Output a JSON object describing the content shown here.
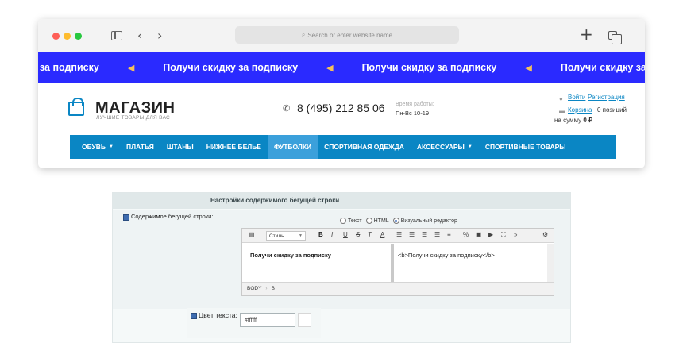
{
  "browser": {
    "address_placeholder": "Search or enter website name",
    "icons": [
      "sidebar-icon",
      "back-icon",
      "forward-icon",
      "search-icon",
      "new-tab-icon",
      "tabs-icon"
    ]
  },
  "ticker": {
    "lead_text": "за подписку",
    "text": "Получи скидку за подписку",
    "background": "#2a2aff"
  },
  "shop": {
    "logo_title": "МАГАЗИН",
    "logo_subtitle": "ЛУЧШИЕ ТОВАРЫ ДЛЯ ВАС",
    "phone": "8 (495) 212 85 06",
    "hours_label": "Время работы:",
    "hours": "Пн-Вс 10-19",
    "login": "Войти",
    "register": "Регистрация",
    "cart_link": "Корзина",
    "cart_count": "0 позиций",
    "cart_sum_prefix": "на сумму",
    "cart_sum_value": "0 ₽",
    "accent": "#0a86c4"
  },
  "menu": {
    "items": [
      {
        "label": "ОБУВЬ",
        "dropdown": true
      },
      {
        "label": "ПЛАТЬЯ"
      },
      {
        "label": "ШТАНЫ"
      },
      {
        "label": "НИЖНЕЕ БЕЛЬЕ"
      },
      {
        "label": "ФУТБОЛКИ",
        "active": true
      },
      {
        "label": "СПОРТИВНАЯ ОДЕЖДА"
      },
      {
        "label": "АКСЕССУАРЫ",
        "dropdown": true
      },
      {
        "label": "СПОРТИВНЫЕ ТОВАРЫ"
      }
    ]
  },
  "settings": {
    "header": "Настройки содержимого бегущей строки",
    "content_label": "Содержимое бегущей строки:",
    "radio": {
      "text": "Текст",
      "html": "HTML",
      "visual": "Визуальный редактор",
      "selected": "visual"
    },
    "editor": {
      "style_select": "Стиль",
      "visual_content": "Получи скидку за подписку",
      "source_content": "<b>Получи скидку за подписку</b>",
      "status_body": "BODY",
      "status_b": "B"
    },
    "color_label": "Цвет текста:",
    "color_value": "#ffffff"
  }
}
